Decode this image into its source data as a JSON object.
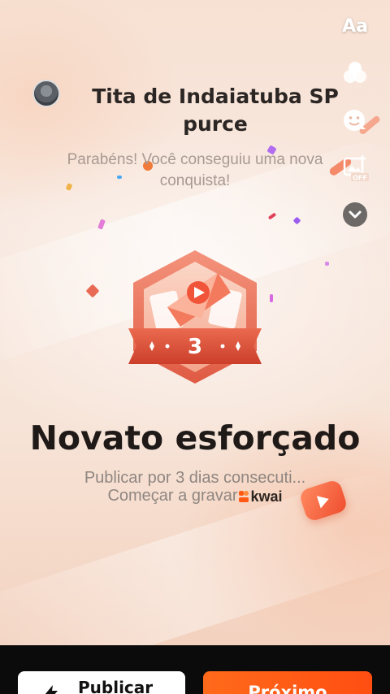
{
  "user": {
    "name": "Tita de Indaiatuba SP purce"
  },
  "tools": {
    "text_label": "Aa"
  },
  "achievement": {
    "congrats": "Parabéns! Você conseguiu uma nova conquista!",
    "badge_level": "3",
    "title": "Novato esforçado",
    "description": "Publicar por 3 dias consecuti...",
    "record_prompt": "Começar a gravar",
    "app_name": "kwai"
  },
  "footer": {
    "publish_label": "Publicar",
    "next_label": "Próximo"
  },
  "colors": {
    "accent": "#ff5a14",
    "badge_primary": "#e8624a",
    "badge_ribbon": "#d94a34"
  }
}
